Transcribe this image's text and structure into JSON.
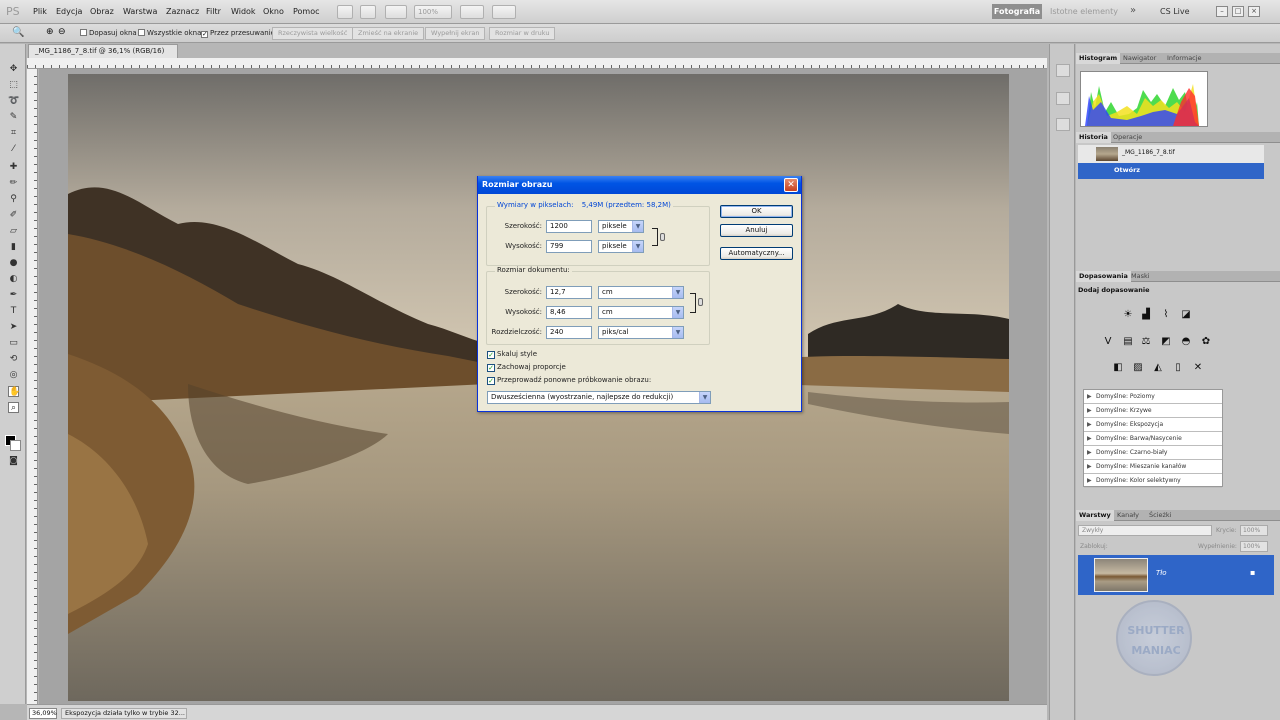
{
  "app": {
    "logo": "PS"
  },
  "menu": [
    "Plik",
    "Edycja",
    "Obraz",
    "Warstwa",
    "Zaznacz",
    "Filtr",
    "Widok",
    "Okno",
    "Pomoc"
  ],
  "menubar": {
    "zoom": "100%",
    "workspace_active": "Fotografia",
    "workspace_2": "Istotne elementy",
    "more": "»",
    "cslive": "CS Live"
  },
  "options": {
    "checks": [
      {
        "label": "Dopasuj okna",
        "checked": false
      },
      {
        "label": "Wszystkie okna",
        "checked": false
      },
      {
        "label": "Przez przesuwanie",
        "checked": true
      }
    ],
    "buttons": [
      "Rzeczywista wielkość",
      "Zmieść na ekranie",
      "Wypełnij ekran",
      "Rozmiar w druku"
    ]
  },
  "document": {
    "tab": "_MG_1186_7_8.tif @ 36,1% (RGB/16)"
  },
  "status": {
    "zoom": "36,09%",
    "text": "Ekspozycja działa tylko w trybie 32..."
  },
  "panels": {
    "top_tabs": [
      "Histogram",
      "Nawigator",
      "Informacje"
    ],
    "history_tabs": [
      "Historia",
      "Operacje"
    ],
    "history_items": [
      "_MG_1186_7_8.tif",
      "Otwórz"
    ],
    "adjust_tabs": [
      "Dopasowania",
      "Maski"
    ],
    "adjust_title": "Dodaj dopasowanie",
    "presets": [
      "Domyślne: Poziomy",
      "Domyślne: Krzywe",
      "Domyślne: Ekspozycja",
      "Domyślne: Barwa/Nasycenie",
      "Domyślne: Czarno-biały",
      "Domyślne: Mieszanie kanałów",
      "Domyślne: Kolor selektywny"
    ],
    "layers_tabs": [
      "Warstwy",
      "Kanały",
      "Ścieżki"
    ],
    "blend_mode": "Zwykły",
    "opacity_label": "Krycie:",
    "opacity": "100%",
    "lock_label": "Zablokuj:",
    "fill_label": "Wypełnienie:",
    "fill": "100%",
    "layer_name": "Tło",
    "watermark_1": "SHUTTER",
    "watermark_2": "MANIAC"
  },
  "dialog": {
    "title": "Rozmiar obrazu",
    "pixel_group": "Wymiary w pikselach:",
    "pixel_size": "5,49M (przedtem: 58,2M)",
    "width_label": "Szerokość:",
    "height_label": "Wysokość:",
    "px_width": "1200",
    "px_height": "799",
    "px_unit": "piksele",
    "doc_group": "Rozmiar dokumentu:",
    "doc_width": "12,7",
    "doc_height": "8,46",
    "doc_unit": "cm",
    "res_label": "Rozdzielczość:",
    "resolution": "240",
    "res_unit": "piks/cal",
    "ok": "OK",
    "cancel": "Anuluj",
    "auto": "Automatyczny...",
    "scale_styles": "Skaluj style",
    "constrain": "Zachowaj proporcje",
    "resample": "Przeprowadź ponowne próbkowanie obrazu:",
    "resample_method": "Dwusześcienna (wyostrzanie, najlepsze do redukcji)"
  }
}
